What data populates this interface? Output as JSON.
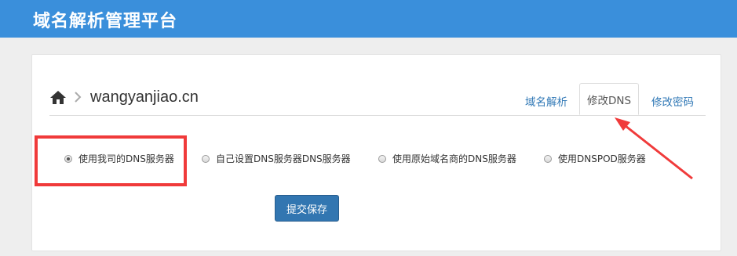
{
  "app": {
    "title": "域名解析管理平台"
  },
  "breadcrumb": {
    "domain": "wangyanjiao.cn"
  },
  "tabs": [
    {
      "label": "域名解析",
      "active": false
    },
    {
      "label": "修改DNS",
      "active": true
    },
    {
      "label": "修改密码",
      "active": false
    }
  ],
  "dns_options": [
    {
      "label": "使用我司的DNS服务器",
      "checked": true
    },
    {
      "label": "自己设置DNS服务器DNS服务器",
      "checked": false
    },
    {
      "label": "使用原始域名商的DNS服务器",
      "checked": false
    },
    {
      "label": "使用DNSPOD服务器",
      "checked": false
    }
  ],
  "submit": {
    "label": "提交保存"
  },
  "colors": {
    "header": "#3a8fdb",
    "link": "#337ab7",
    "button": "#3276b1",
    "annotation": "#f03a3a"
  },
  "icons": {
    "home": "home-icon",
    "separator": "chevron-right-icon"
  }
}
